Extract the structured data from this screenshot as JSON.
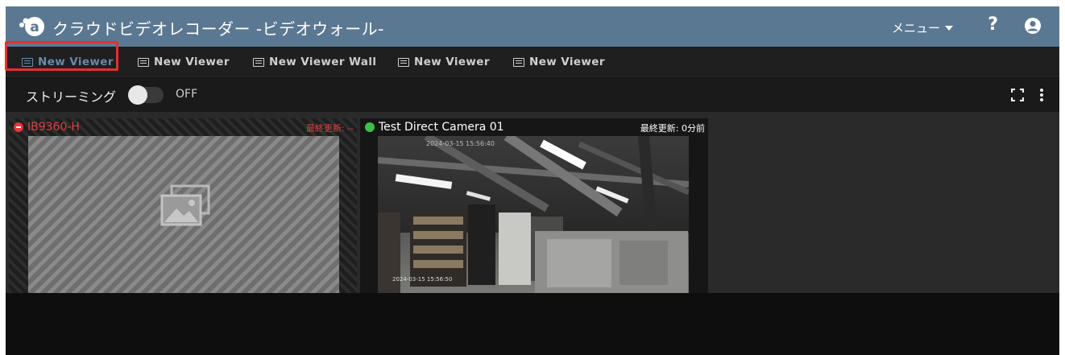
{
  "header": {
    "title": "クラウドビデオレコーダー -ビデオウォール-",
    "menu_label": "メニュー",
    "help_label": "?",
    "logo_icon": "cloud-recorder-logo",
    "user_icon": "user-icon"
  },
  "tabs": [
    {
      "label": "New Viewer",
      "active": true
    },
    {
      "label": "New Viewer",
      "active": false
    },
    {
      "label": "New Viewer Wall",
      "active": false
    },
    {
      "label": "New Viewer",
      "active": false
    },
    {
      "label": "New Viewer",
      "active": false
    }
  ],
  "toolbar": {
    "streaming_label": "ストリーミング",
    "toggle_state": "OFF",
    "fullscreen_icon": "fullscreen-icon",
    "more_icon": "more-vertical-icon"
  },
  "cameras": [
    {
      "name": "IB9360-H",
      "status": "offline",
      "updated_label": "最終更新: --",
      "status_color": "#e03838"
    },
    {
      "name": "Test Direct Camera 01",
      "status": "online",
      "updated_label": "最終更新: 0分前",
      "status_color": "#3fbf4a"
    }
  ],
  "colors": {
    "header_bg": "#5b7892",
    "active_tab": "#6d87a8",
    "highlight_border": "#e53030"
  }
}
